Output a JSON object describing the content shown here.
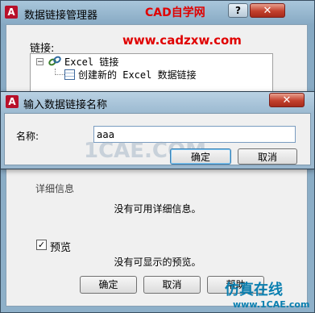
{
  "main_window": {
    "title": "数据链接管理器",
    "logo_letter": "A",
    "help_button": "?",
    "close_button": "✕",
    "links_label": "链接:",
    "tree": {
      "toggle": "−",
      "root_label": "Excel 链接",
      "child_label": "创建新的 Excel 数据链接"
    },
    "details_group_label": "详细信息",
    "details_text": "没有可用详细信息。",
    "preview_checkbox_label": "预览",
    "preview_checked": "✓",
    "preview_text": "没有可显示的预览。",
    "buttons": {
      "ok": "确定",
      "cancel": "取消",
      "help": "帮助"
    }
  },
  "name_dialog": {
    "title": "输入数据链接名称",
    "logo_letter": "A",
    "close_button": "✕",
    "name_label": "名称:",
    "name_value": "aaa",
    "buttons": {
      "ok": "确定",
      "cancel": "取消"
    }
  },
  "watermarks": {
    "top": "CAD自学网",
    "url": "www.cadzxw.com",
    "mid": "1CAE.COM",
    "bottom_logo": "仿真在线",
    "bottom_url": "www.1CAE.com"
  }
}
